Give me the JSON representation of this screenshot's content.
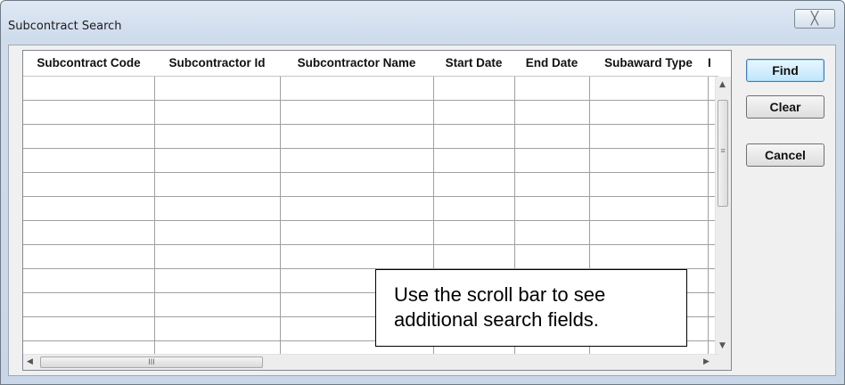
{
  "window": {
    "title": "Subcontract Search",
    "close_glyph": "╳"
  },
  "grid": {
    "columns": [
      "Subcontract Code",
      "Subcontractor Id",
      "Subcontractor Name",
      "Start Date",
      "End Date",
      "Subaward Type",
      "I"
    ],
    "rows": [
      [
        "",
        "",
        "",
        "",
        "",
        "",
        ""
      ],
      [
        "",
        "",
        "",
        "",
        "",
        "",
        ""
      ],
      [
        "",
        "",
        "",
        "",
        "",
        "",
        ""
      ],
      [
        "",
        "",
        "",
        "",
        "",
        "",
        ""
      ],
      [
        "",
        "",
        "",
        "",
        "",
        "",
        ""
      ],
      [
        "",
        "",
        "",
        "",
        "",
        "",
        ""
      ],
      [
        "",
        "",
        "",
        "",
        "",
        "",
        ""
      ],
      [
        "",
        "",
        "",
        "",
        "",
        "",
        ""
      ],
      [
        "",
        "",
        "",
        "",
        "",
        "",
        ""
      ],
      [
        "",
        "",
        "",
        "",
        "",
        "",
        ""
      ],
      [
        "",
        "",
        "",
        "",
        "",
        "",
        ""
      ]
    ],
    "scroll": {
      "up_glyph": "▲",
      "down_glyph": "▼",
      "left_glyph": "◀",
      "right_glyph": "▶",
      "grip": "≡",
      "hgrip": "III"
    }
  },
  "buttons": {
    "find": "Find",
    "clear": "Clear",
    "cancel": "Cancel"
  },
  "callout": {
    "text": "Use the scroll bar to see additional search fields."
  },
  "colors": {
    "title_gradient_top": "#dfe9f5",
    "default_button": "#bee6fd",
    "grid_lines": "#a0a0a0"
  }
}
